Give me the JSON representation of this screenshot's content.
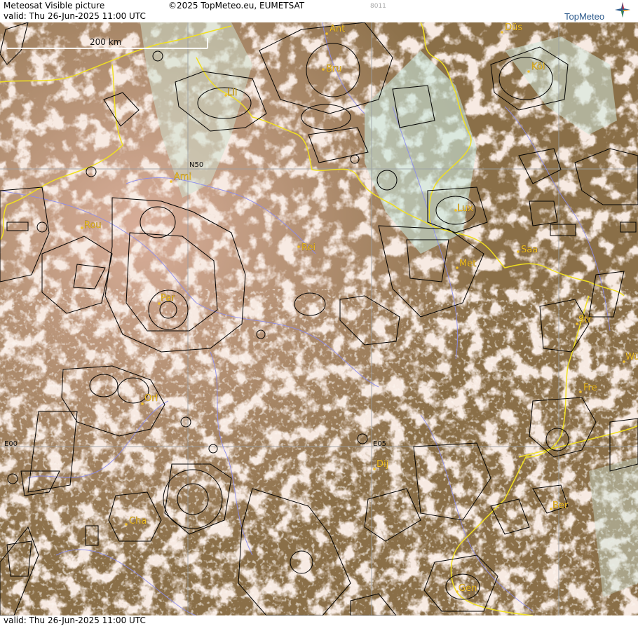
{
  "header": {
    "title": "Meteosat Visible picture",
    "valid_line": "valid:  Thu   26-Jun-2025   11:00 UTC",
    "copyright": "©2025 TopMeteo.eu, EUMETSAT",
    "code": "8011",
    "logo_text": "TopMeteo"
  },
  "footer": {
    "valid_line": "valid:  Thu   26-Jun-2025   11:00 UTC"
  },
  "map": {
    "scale_label": "200 km",
    "grid_labels": {
      "lat50": "N50",
      "lon0": "E00",
      "lon5": "E05"
    },
    "cities": [
      "Ant",
      "Düs",
      "Bru",
      "Köl",
      "Lil",
      "Ami",
      "Rou",
      "Rei",
      "Lux",
      "Saa",
      "Met",
      "Par",
      "Str",
      "Fre",
      "Orl",
      "Dij",
      "Ber",
      "Cha",
      "Gen",
      "Wü"
    ]
  },
  "colors": {
    "border": "#f0e020",
    "river": "#8c8cf0",
    "airspace": "#000000",
    "city": "#f0c028",
    "grid": "#9aa0a6",
    "logo_blue": "#2d5a8c"
  }
}
